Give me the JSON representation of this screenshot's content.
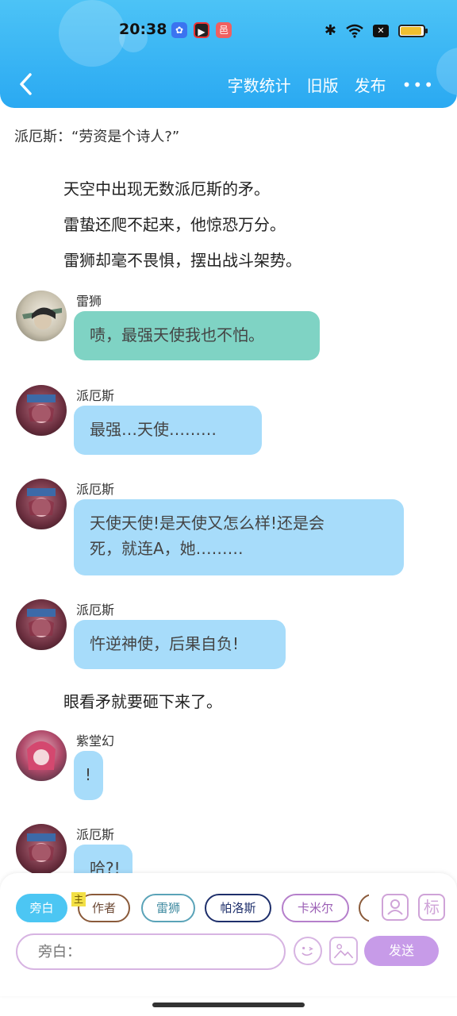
{
  "status_bar": {
    "time": "20:38",
    "icons": [
      "baidu-icon",
      "video-app-icon",
      "red-app-icon",
      "bluetooth-icon",
      "wifi-icon",
      "xbox-icon",
      "battery-icon"
    ]
  },
  "nav": {
    "back_icon": "chevron-left-icon",
    "word_count": "字数统计",
    "old_version": "旧版",
    "publish": "发布",
    "more": "•••"
  },
  "content": {
    "quote_line": "派厄斯：“劳资是个诗人?”",
    "narration_1": [
      "天空中出现无数派厄斯的矛。",
      "雷蛰还爬不起来，他惊恐万分。",
      "雷狮却毫不畏惧，摆出战斗架势。"
    ],
    "messages": [
      {
        "speaker": "雷狮",
        "text": "啧，最强天使我也不怕。"
      },
      {
        "speaker": "派厄斯",
        "text": "最强…天使………"
      },
      {
        "speaker": "派厄斯",
        "text_line1": "天使天使!是天使又怎么样!还是会",
        "text_line2": "死，就连A，她………"
      },
      {
        "speaker": "派厄斯",
        "text": "忤逆神使，后果自负!"
      },
      {
        "speaker": "紫堂幻",
        "text": "!"
      },
      {
        "speaker": "派厄斯",
        "text": "哈?!"
      }
    ],
    "narration_2": "眼看矛就要砸下来了。"
  },
  "composer": {
    "roles": [
      {
        "label": "旁白",
        "selected": true
      },
      {
        "label": "作者",
        "badge": "主"
      },
      {
        "label": "雷狮"
      },
      {
        "label": "帕洛斯"
      },
      {
        "label": "卡米尔"
      }
    ],
    "input_placeholder": "旁白：",
    "send_label": "发送",
    "side_icon_tag": "标",
    "colors": {
      "narrator_chip_bg": "#4cc6f3",
      "send_bg": "#c79be8",
      "leishi_bubble": "#7fd3c4",
      "paies_bubble": "#a7dcfa",
      "header": "#2aa9f2"
    }
  }
}
